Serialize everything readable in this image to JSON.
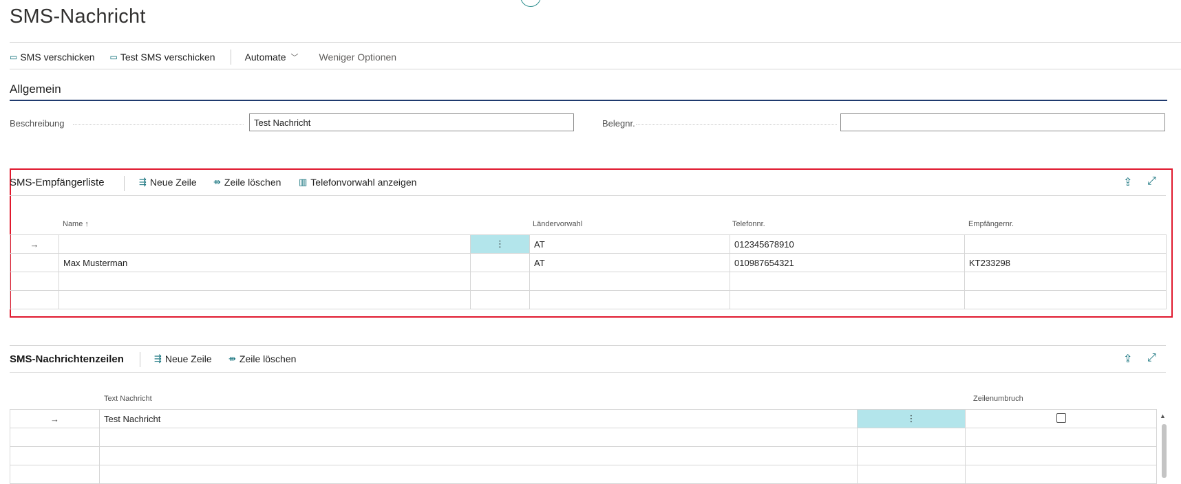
{
  "page": {
    "title": "SMS-Nachricht"
  },
  "actions": {
    "send_sms": "SMS verschicken",
    "send_test_sms": "Test SMS verschicken",
    "automate": "Automate",
    "fewer_options": "Weniger Optionen"
  },
  "general": {
    "title": "Allgemein",
    "description_label": "Beschreibung",
    "description_value": "Test Nachricht",
    "docno_label": "Belegnr.",
    "docno_value": ""
  },
  "recipients": {
    "title": "SMS-Empfängerliste",
    "new_line": "Neue Zeile",
    "delete_line": "Zeile löschen",
    "show_prefix": "Telefonvorwahl anzeigen",
    "columns": {
      "name": "Name",
      "sort_indicator": "↑",
      "country_code": "Ländervorwahl",
      "phone": "Telefonnr.",
      "recipient_no": "Empfängernr."
    },
    "rows": [
      {
        "name": "",
        "country_code": "AT",
        "phone": "012345678910",
        "recipient_no": ""
      },
      {
        "name": "Max Musterman",
        "country_code": "AT",
        "phone": "010987654321",
        "recipient_no": "KT233298"
      },
      {
        "name": "",
        "country_code": "",
        "phone": "",
        "recipient_no": ""
      },
      {
        "name": "",
        "country_code": "",
        "phone": "",
        "recipient_no": ""
      }
    ]
  },
  "message_lines": {
    "title": "SMS-Nachrichtenzeilen",
    "new_line": "Neue Zeile",
    "delete_line": "Zeile löschen",
    "columns": {
      "text": "Text Nachricht",
      "line_break": "Zeilenumbruch"
    },
    "rows": [
      {
        "text": "Test Nachricht"
      },
      {
        "text": ""
      },
      {
        "text": ""
      },
      {
        "text": ""
      }
    ]
  },
  "colors": {
    "accent": "#0f6f7a",
    "selected_cell": "#b3e5eb",
    "highlight_frame": "#e0182d",
    "section_underline": "#1f3a6e"
  },
  "icons": {
    "send": "sms-send-icon",
    "new_line": "new-line-icon",
    "delete_line": "delete-line-icon",
    "columns": "columns-icon",
    "share": "share-icon",
    "expand": "expand-icon",
    "row_arrow": "→",
    "more": "⋮"
  }
}
